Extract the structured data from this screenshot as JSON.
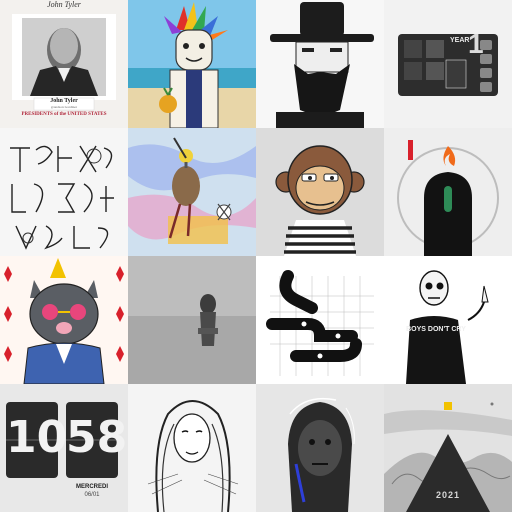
{
  "gallery": {
    "tiles": [
      {
        "title_name": "John Tyler",
        "subtitle": "PRESIDENTS of the UNITED STATES",
        "caption": "grandson Gardiner",
        "signature": "John Tyler"
      },
      {},
      {},
      {
        "year_label": "YEAR",
        "year_number": "1"
      },
      {},
      {},
      {},
      {},
      {},
      {},
      {},
      {
        "shirt_text": "BOYS DON'T CRY"
      },
      {
        "hour": "10",
        "minute": "58",
        "weekday": "MERCREDI",
        "date": "06/01"
      },
      {},
      {},
      {
        "year": "2021"
      }
    ]
  },
  "colors": {
    "ape_fur": "#8a5a3c",
    "ape_face": "#e7c08f",
    "cat_fur": "#5a5e64",
    "cat_jacket": "#3e63b0",
    "gold": "#f2c200",
    "red": "#d8202b",
    "flame": "#f06a1a",
    "sky": "#7fc6ea",
    "sea": "#3fa6c8"
  }
}
